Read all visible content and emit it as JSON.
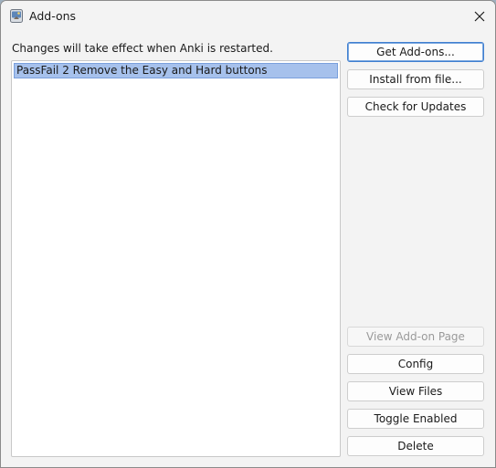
{
  "window": {
    "title": "Add-ons",
    "icon": "anki-icon",
    "close_icon": "close-icon"
  },
  "hint": "Changes will take effect when Anki is restarted.",
  "addons": [
    {
      "label": "PassFail 2 Remove the Easy and Hard buttons",
      "selected": true
    }
  ],
  "buttons": {
    "get_addons": "Get Add-ons...",
    "install_from_file": "Install from file...",
    "check_updates": "Check for Updates",
    "view_addon_page": "View Add-on Page",
    "config": "Config",
    "view_files": "View Files",
    "toggle_enabled": "Toggle Enabled",
    "delete": "Delete"
  },
  "colors": {
    "selection": "#a6c1ec",
    "default_button_border": "#3f7fd0"
  }
}
